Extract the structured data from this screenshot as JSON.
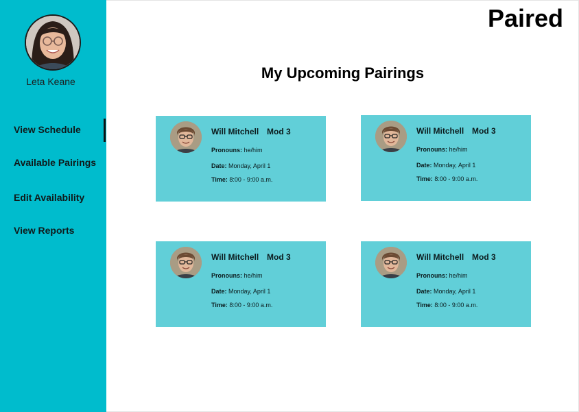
{
  "app": {
    "brand": "Paired"
  },
  "profile": {
    "name": "Leta Keane"
  },
  "nav": {
    "items": [
      {
        "label": "View Schedule"
      },
      {
        "label": "Available Pairings"
      },
      {
        "label": "Edit Availability"
      },
      {
        "label": "View Reports"
      }
    ],
    "active_index": 0
  },
  "main": {
    "title": "My Upcoming Pairings",
    "pairings": [
      {
        "name": "Will Mitchell",
        "mod": "Mod 3",
        "pronouns_label": "Pronouns:",
        "pronouns": "he/him",
        "date_label": "Date:",
        "date": "Monday, April 1",
        "time_label": "Time:",
        "time": "8:00 - 9:00 a.m."
      },
      {
        "name": "Will Mitchell",
        "mod": "Mod 3",
        "pronouns_label": "Pronouns:",
        "pronouns": "he/him",
        "date_label": "Date:",
        "date": "Monday, April 1",
        "time_label": "Time:",
        "time": "8:00 - 9:00 a.m."
      },
      {
        "name": "Will Mitchell",
        "mod": "Mod 3",
        "pronouns_label": "Pronouns:",
        "pronouns": "he/him",
        "date_label": "Date:",
        "date": "Monday, April 1",
        "time_label": "Time:",
        "time": "8:00 - 9:00 a.m."
      },
      {
        "name": "Will Mitchell",
        "mod": "Mod 3",
        "pronouns_label": "Pronouns:",
        "pronouns": "he/him",
        "date_label": "Date:",
        "date": "Monday, April 1",
        "time_label": "Time:",
        "time": "8:00 - 9:00 a.m."
      }
    ]
  },
  "colors": {
    "sidebar": "#00bccd",
    "card": "#61cfd8",
    "text": "#000000"
  }
}
